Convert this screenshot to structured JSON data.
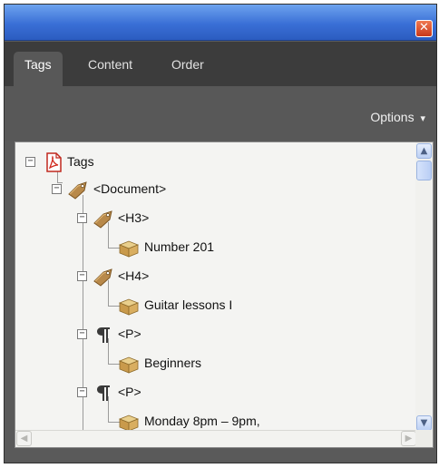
{
  "window": {
    "close_glyph": "✕"
  },
  "tabs": [
    {
      "label": "Tags",
      "active": true
    },
    {
      "label": "Content",
      "active": false
    },
    {
      "label": "Order",
      "active": false
    }
  ],
  "options_label": "Options",
  "options_arrow": "▾",
  "tree": {
    "items": [
      {
        "label": "Tags",
        "icon": "pdf-icon",
        "expanded": true
      },
      {
        "label": "<Document>",
        "icon": "tag-icon",
        "expanded": true
      },
      {
        "label": "<H3>",
        "icon": "tag-icon",
        "expanded": true
      },
      {
        "label": "Number 201",
        "icon": "content-box-icon"
      },
      {
        "label": "<H4>",
        "icon": "tag-icon",
        "expanded": true
      },
      {
        "label": "Guitar lessons I",
        "icon": "content-box-icon"
      },
      {
        "label": "<P>",
        "icon": "paragraph-icon",
        "expanded": true
      },
      {
        "label": "Beginners",
        "icon": "content-box-icon"
      },
      {
        "label": "<P>",
        "icon": "paragraph-icon",
        "expanded": true
      },
      {
        "label": "Monday 8pm – 9pm,",
        "icon": "content-box-icon"
      }
    ],
    "expander_minus": "−"
  },
  "scrollbar": {
    "up": "▲",
    "down": "▼",
    "left": "◀",
    "right": "▶"
  }
}
